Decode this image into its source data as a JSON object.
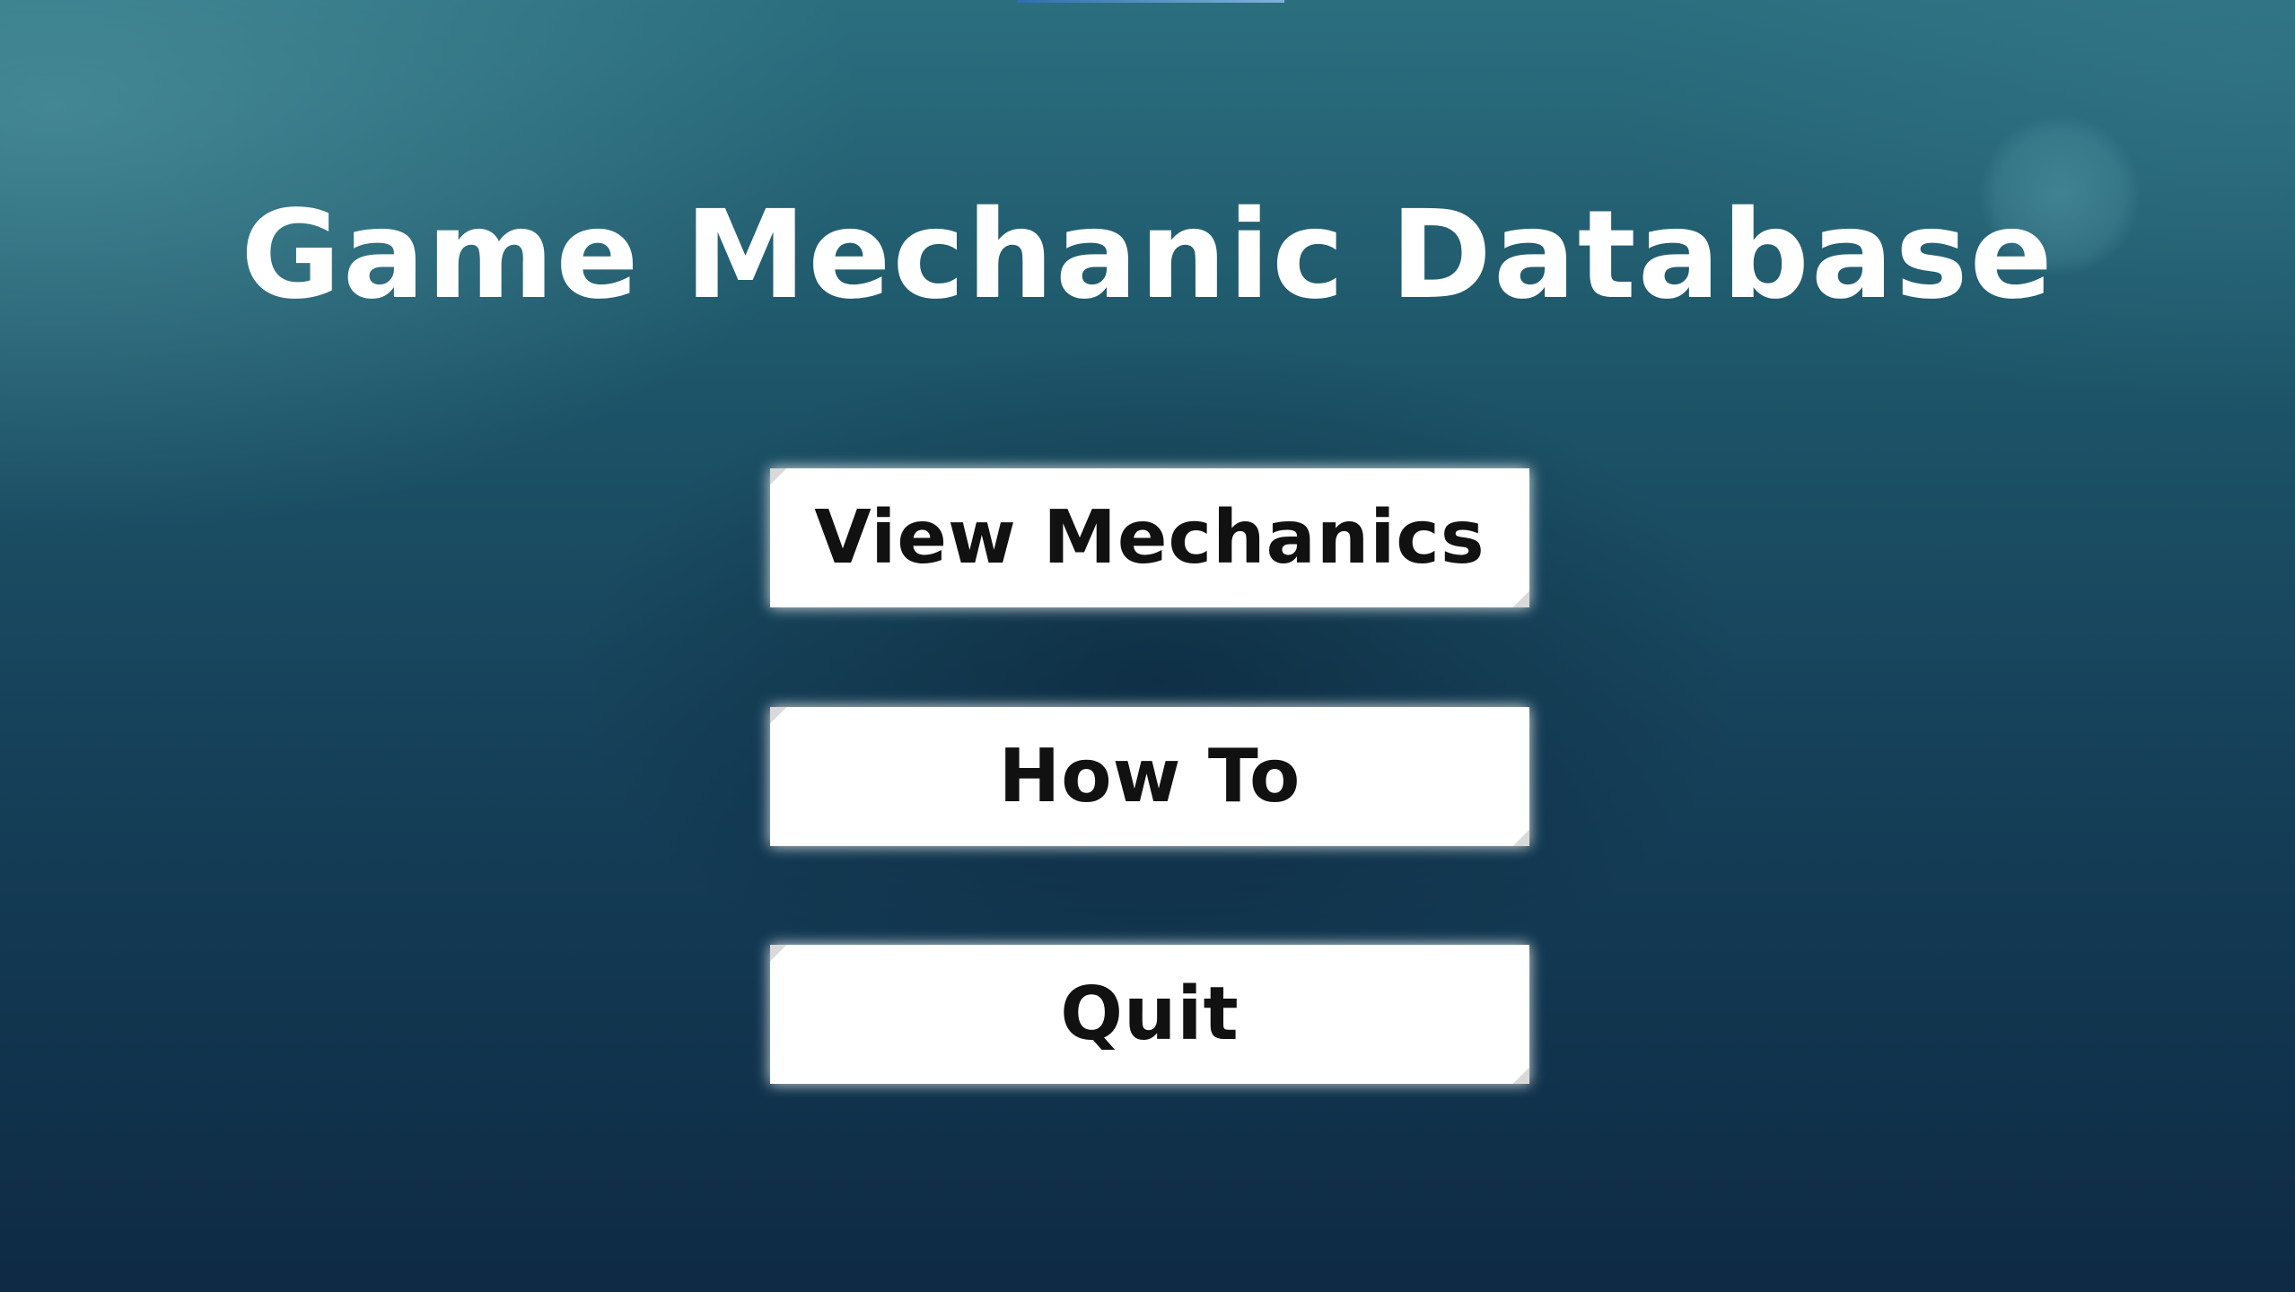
{
  "menu": {
    "title": "Game Mechanic Database",
    "buttons": [
      {
        "id": "view-mechanics",
        "label": "View Mechanics"
      },
      {
        "id": "how-to",
        "label": "How To"
      },
      {
        "id": "quit",
        "label": "Quit"
      }
    ]
  },
  "colors": {
    "background_top": "#2b6f7f",
    "background_bottom": "#0e2a44",
    "title_text": "#ffffff",
    "button_fill": "#ffffff",
    "button_text": "#111111"
  }
}
